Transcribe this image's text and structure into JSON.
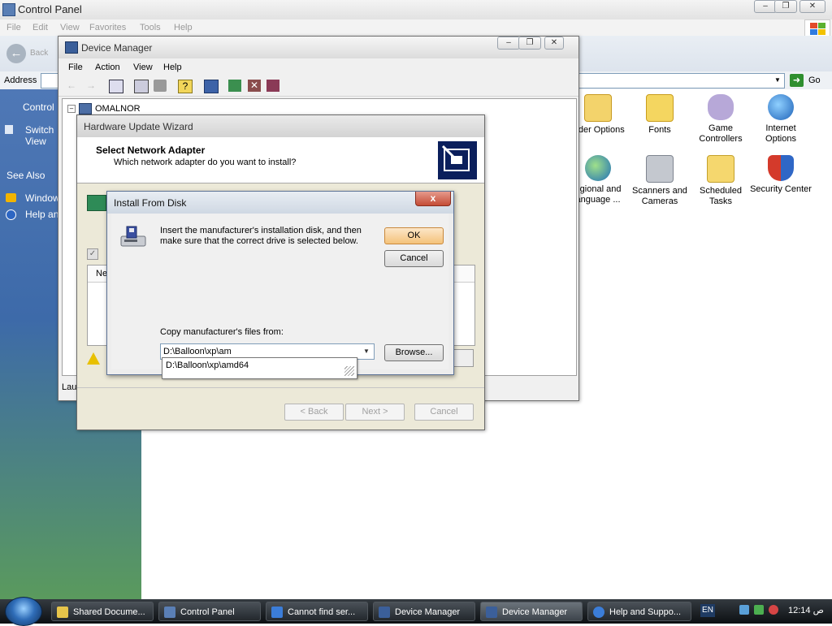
{
  "control_panel": {
    "title": "Control Panel",
    "menu": [
      "File",
      "Edit",
      "View",
      "Favorites",
      "Tools",
      "Help"
    ],
    "back_label": "Back",
    "address_label": "Address",
    "go_label": "Go",
    "sidebar": {
      "control_label": "Control",
      "switch_view": [
        "Switch",
        "View"
      ],
      "see_also": "See Also",
      "links": [
        "Window",
        "Help an"
      ]
    },
    "items": [
      {
        "label": "older Options",
        "icon": "folder-options-icon"
      },
      {
        "label": "Fonts",
        "icon": "fonts-folder-icon"
      },
      {
        "label": "Game Controllers",
        "icon": "game-controller-icon"
      },
      {
        "label": "Internet Options",
        "icon": "internet-globe-icon"
      },
      {
        "label": "egional and anguage ...",
        "icon": "globe-icon"
      },
      {
        "label": "Scanners and Cameras",
        "icon": "scanner-camera-icon"
      },
      {
        "label": "Scheduled Tasks",
        "icon": "scheduled-tasks-icon"
      },
      {
        "label": "Security Center",
        "icon": "shield-icon"
      }
    ]
  },
  "device_manager": {
    "title": "Device Manager",
    "menu": [
      "File",
      "Action",
      "View",
      "Help"
    ],
    "root_node": "OMALNOR",
    "status_text": "Lau"
  },
  "wizard": {
    "title": "Hardware Update Wizard",
    "heading": "Select Network Adapter",
    "subheading": "Which network adapter do you want to install?",
    "list_column": "Ne",
    "buttons": {
      "back": "< Back",
      "next": "Next >",
      "cancel": "Cancel"
    }
  },
  "install_from_disk": {
    "title": "Install From Disk",
    "close_glyph": "x",
    "message": "Insert the manufacturer's installation disk, and then make sure that the correct drive is selected below.",
    "ok_label": "OK",
    "cancel_label": "Cancel",
    "copy_label": "Copy manufacturer's files from:",
    "path_value": "D:\\Balloon\\xp\\am",
    "autocomplete_suggestion": "D:\\Balloon\\xp\\amd64",
    "browse_label": "Browse..."
  },
  "taskbar": {
    "tasks": [
      {
        "label": "Shared Docume...",
        "icon_color": "#e6c44a"
      },
      {
        "label": "Control Panel",
        "icon_color": "#5a7fb5"
      },
      {
        "label": "Cannot find ser...",
        "icon_color": "#3b7dd8"
      },
      {
        "label": "Device Manager",
        "icon_color": "#3b5f9a"
      },
      {
        "label": "Device Manager",
        "icon_color": "#3b5f9a"
      },
      {
        "label": "Help and Suppo...",
        "icon_color": "#3b7dd8"
      }
    ],
    "language": "EN",
    "clock": "ص 12:14"
  }
}
